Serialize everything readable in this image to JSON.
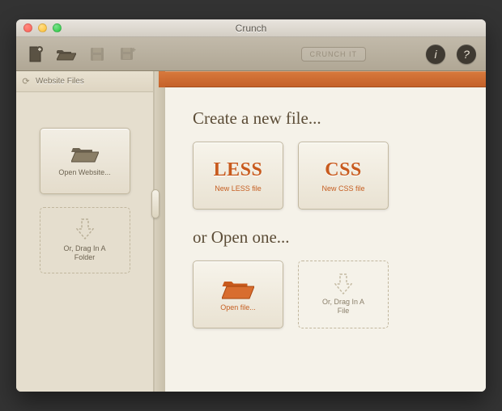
{
  "window": {
    "title": "Crunch"
  },
  "toolbar": {
    "brand": "CRUNCH IT"
  },
  "sidebar": {
    "header": "Website Files",
    "open_website": "Open Website...",
    "drag_folder": "Or, Drag In A\nFolder"
  },
  "main": {
    "create_heading": "Create a new file...",
    "less_title": "LESS",
    "less_sub": "New LESS file",
    "css_title": "CSS",
    "css_sub": "New CSS file",
    "open_heading": "or Open one...",
    "open_file": "Open file...",
    "drag_file": "Or, Drag In A\nFile"
  }
}
